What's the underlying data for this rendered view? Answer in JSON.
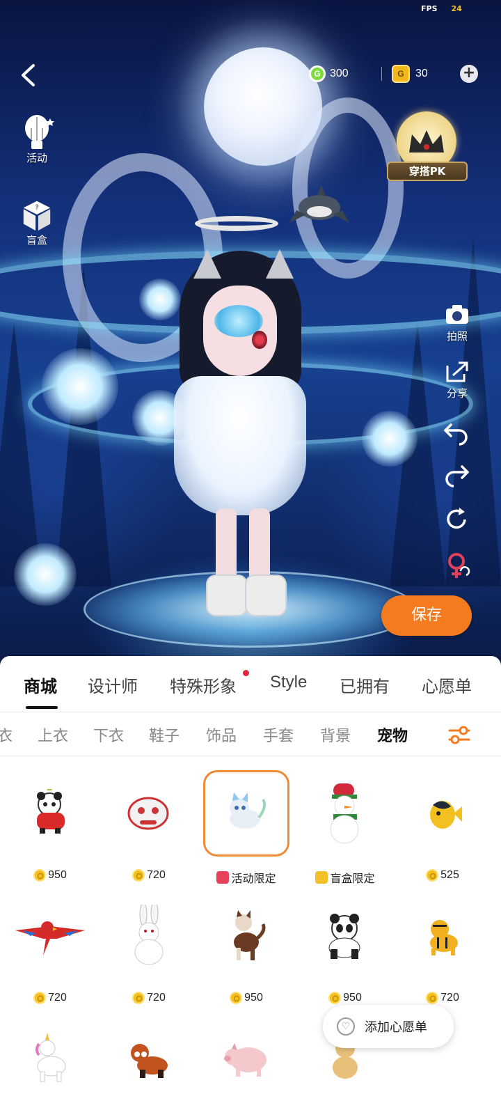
{
  "status": {
    "fps_label": "FPS",
    "fps_value": "24"
  },
  "currency": {
    "green_amount": "300",
    "gold_amount": "30"
  },
  "side_left": [
    {
      "label": "活动",
      "icon": "balloon-icon"
    },
    {
      "label": "盲盒",
      "icon": "mystery-box-icon"
    }
  ],
  "side_right": [
    {
      "label": "拍照",
      "icon": "camera-icon"
    },
    {
      "label": "分享",
      "icon": "share-icon"
    }
  ],
  "pk_badge": {
    "label": "穿搭PK",
    "icon": "crown-icon"
  },
  "save_label": "保存",
  "tabs": [
    "商城",
    "设计师",
    "特殊形象",
    "Style",
    "已拥有",
    "心愿单"
  ],
  "categories": [
    "衣",
    "上衣",
    "下衣",
    "鞋子",
    "饰品",
    "手套",
    "背景",
    "宠物"
  ],
  "items": [
    {
      "name": "panda-red-vest",
      "price": "950",
      "tag": "coin"
    },
    {
      "name": "lion-dance",
      "price": "720",
      "tag": "coin"
    },
    {
      "name": "crystal-cat",
      "price": "活动限定",
      "tag": "event"
    },
    {
      "name": "snowman",
      "price": "盲盒限定",
      "tag": "box"
    },
    {
      "name": "fish",
      "price": "525",
      "tag": "coin"
    },
    {
      "name": "parrot",
      "price": "720",
      "tag": "coin"
    },
    {
      "name": "white-rabbit",
      "price": "720",
      "tag": "coin"
    },
    {
      "name": "calico-cat",
      "price": "950",
      "tag": "coin"
    },
    {
      "name": "panda",
      "price": "950",
      "tag": "coin"
    },
    {
      "name": "tiger-cub",
      "price": "720",
      "tag": "coin"
    },
    {
      "name": "unicorn",
      "price": "",
      "tag": ""
    },
    {
      "name": "red-panda",
      "price": "",
      "tag": ""
    },
    {
      "name": "pig",
      "price": "",
      "tag": ""
    },
    {
      "name": "shiba-dog",
      "price": "",
      "tag": ""
    }
  ],
  "wishlist_button": "添加心愿单",
  "colors": {
    "accent": "#f47b20",
    "tab_badge": "#e8213a",
    "selected_border": "#f08a35"
  }
}
